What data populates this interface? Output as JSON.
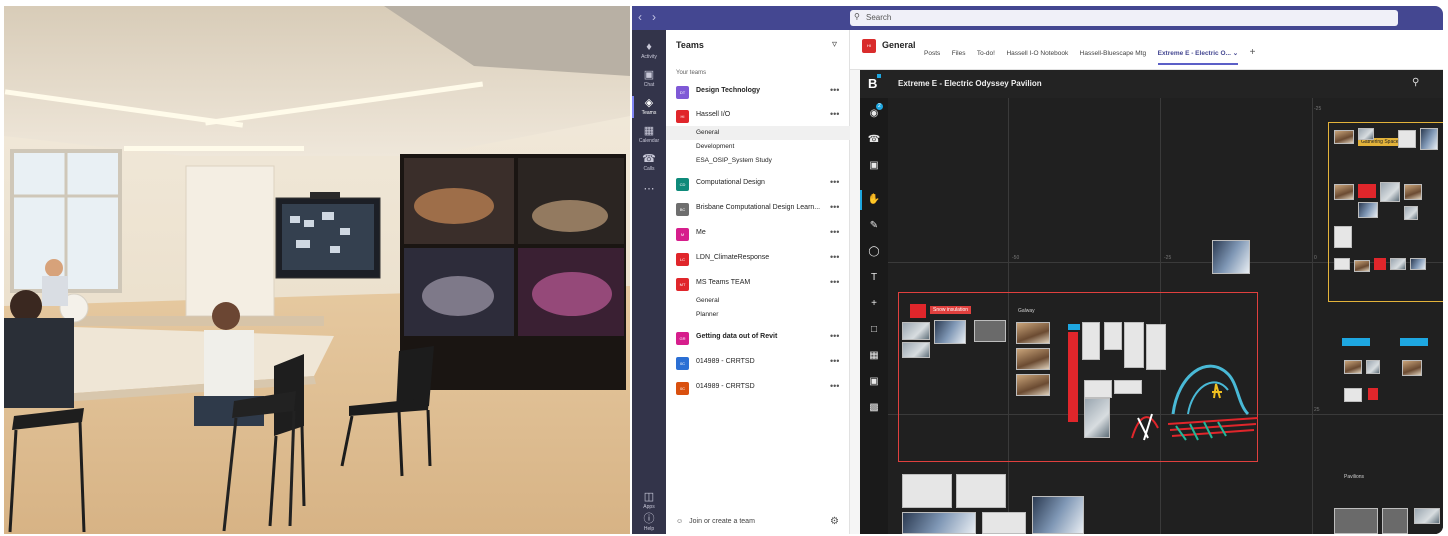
{
  "photo": {
    "icon": "meeting-room-photo"
  },
  "teams_app": {
    "search_placeholder": "Search",
    "rail": [
      {
        "icon": "bell-icon",
        "label": "Activity"
      },
      {
        "icon": "chat-icon",
        "label": "Chat"
      },
      {
        "icon": "teams-icon",
        "label": "Teams"
      },
      {
        "icon": "calendar-icon",
        "label": "Calendar"
      },
      {
        "icon": "phone-icon",
        "label": "Calls"
      },
      {
        "icon": "ellipsis-icon",
        "label": ""
      },
      {
        "icon": "apps-icon",
        "label": "Apps"
      },
      {
        "icon": "help-icon",
        "label": "Help"
      }
    ],
    "list_title": "Teams",
    "your_teams_label": "Your teams",
    "teams": [
      {
        "initials": "DT",
        "name": "Design Technology",
        "color": "#7f59d6",
        "bold": true
      },
      {
        "initials": "HI",
        "name": "Hassell I/O",
        "color": "#e0262b",
        "bold": false
      },
      {
        "initials": "CD",
        "name": "Computational Design",
        "color": "#0e8a7a",
        "bold": false
      },
      {
        "initials": "BC",
        "name": "Brisbane Computational Design Learn...",
        "color": "#6e6e6e",
        "bold": false
      },
      {
        "initials": "M",
        "name": "Me",
        "color": "#d61e8c",
        "bold": false
      },
      {
        "initials": "LC",
        "name": "LDN_ClimateResponse",
        "color": "#e0262b",
        "bold": false
      },
      {
        "initials": "MT",
        "name": "MS Teams TEAM",
        "color": "#e0262b",
        "bold": false
      },
      {
        "initials": "GR",
        "name": "Getting data out of Revit",
        "color": "#d61e8c",
        "bold": true
      },
      {
        "initials": "0C",
        "name": "014989 - CRRTSD",
        "color": "#2b6fd4",
        "bold": false
      },
      {
        "initials": "0C",
        "name": "014989 - CRRTSD",
        "color": "#d9500f",
        "bold": false
      }
    ],
    "channels_hassell": [
      "General",
      "Development",
      "ESA_OSIP_System Study"
    ],
    "channels_msteams": [
      "General",
      "Planner"
    ],
    "more_label": "•••",
    "join_label": "Join or create a team",
    "channel_avatar": "HI",
    "channel_name": "General",
    "tabs": [
      "Posts",
      "Files",
      "To-do!",
      "Hassell I-O Notebook",
      "Hassell-Bluescape Mtg",
      "Extreme E - Electric O..."
    ],
    "active_tab_index": 5,
    "tab_chevron": "⌄",
    "tab_add": "+"
  },
  "bluescape": {
    "logo": "B",
    "title": "Extreme E - Electric Odyssey Pavilion",
    "notification_count": "2",
    "tools": [
      "touch-icon",
      "phone-icon",
      "comment-icon",
      "hand-icon",
      "pen-icon",
      "shapes-icon",
      "text-icon",
      "add-icon",
      "note-icon",
      "grid-icon",
      "focus-icon",
      "fit-icon"
    ],
    "ticks": [
      "-50",
      "-25",
      "0",
      "-25",
      "25"
    ],
    "labels": {
      "snow": "Snow insulation",
      "gathering": "Gathering Spaces",
      "pavilions": "Pavilions",
      "galway": "Galway"
    },
    "accent_colors": {
      "red": "#e0262b",
      "blue": "#1ea7e1",
      "yellow": "#e3b33a",
      "teams_purple": "#444791"
    }
  }
}
